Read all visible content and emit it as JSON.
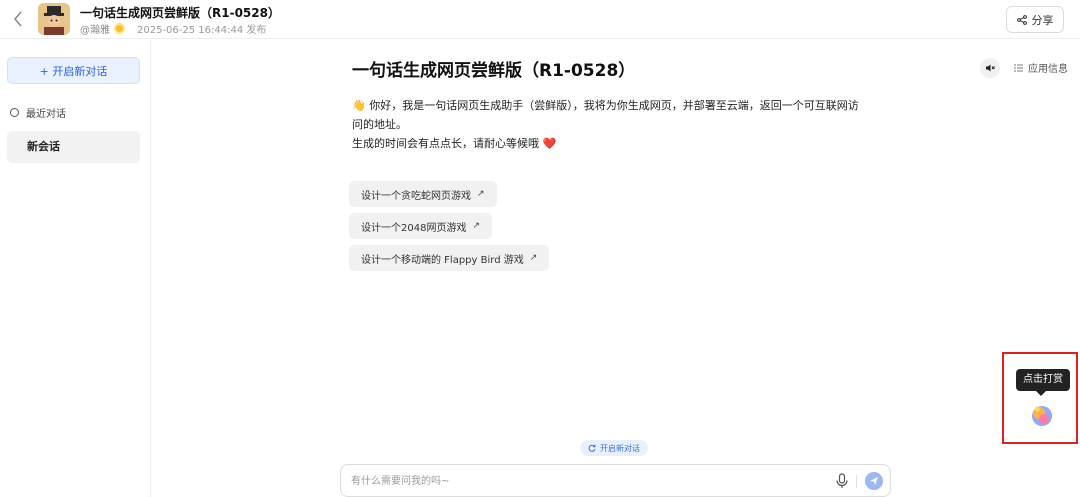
{
  "header": {
    "back_icon": "chevron-left-icon",
    "app_title": "一句话生成网页尝鲜版（R1-0528）",
    "author": "@瀚雅",
    "publish_date": "2025-06-25 16:44:44 发布",
    "share_label": "分享"
  },
  "sidebar": {
    "new_chat_label": "+ 开启新对话",
    "recent_label": "最近对话",
    "session_label": "新会话"
  },
  "chat": {
    "title": "一句话生成网页尝鲜版（R1-0528）",
    "app_info_label": "应用信息",
    "greeting_line1": "👋 你好，我是一句话网页生成助手（尝鲜版），我将为你生成网页，并部署至云端，返回一个可互联网访",
    "greeting_line2": "问的地址。",
    "greeting_line3": "生成的时间会有点点长，请耐心等候哦 ❤️",
    "suggestions": [
      "设计一个贪吃蛇网页游戏",
      "设计一个2048网页游戏",
      "设计一个移动端的 Flappy Bird 游戏"
    ],
    "suggestion_arrow": "↗",
    "new_chat_pill": "开启新对话",
    "input_placeholder": "有什么需要问我的吗~"
  },
  "reward": {
    "tooltip": "点击打赏"
  },
  "colors": {
    "accent": "#2a62e6",
    "highlight_border": "#e02020",
    "sun_badge": "#f5c12b"
  }
}
